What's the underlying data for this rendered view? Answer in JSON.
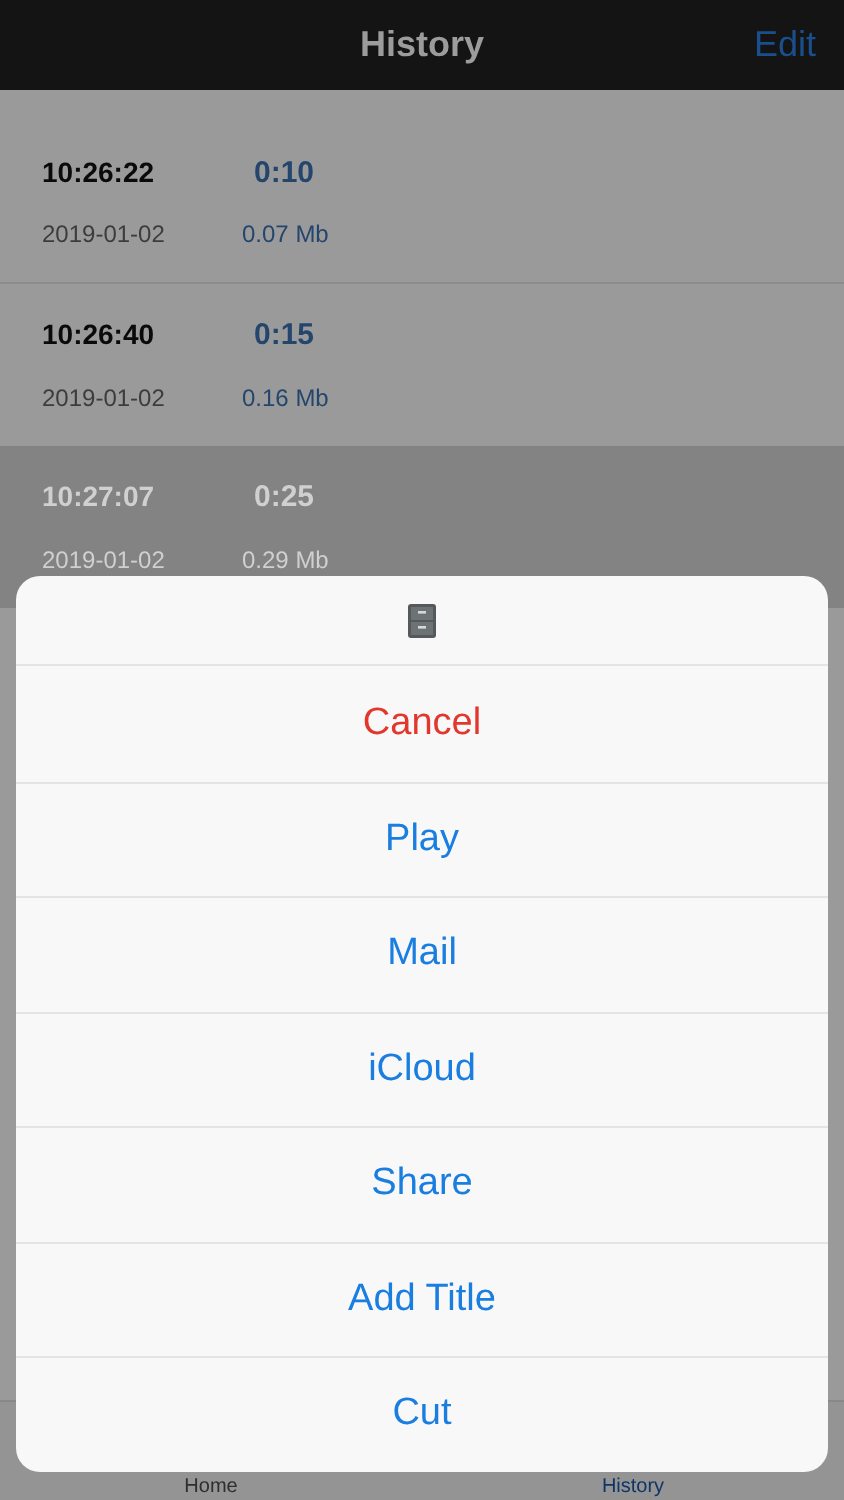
{
  "nav_bar": {
    "title": "History",
    "edit_button": "Edit"
  },
  "recordings": [
    {
      "time": "10:26:22",
      "date": "2019-01-02",
      "duration": "0:10",
      "size": "0.07 Mb",
      "selected": false
    },
    {
      "time": "10:26:40",
      "date": "2019-01-02",
      "duration": "0:15",
      "size": "0.16 Mb",
      "selected": false
    },
    {
      "time": "10:27:07",
      "date": "2019-01-02",
      "duration": "0:25",
      "size": "0.29 Mb",
      "selected": true
    }
  ],
  "action_sheet": {
    "actions": [
      {
        "label": "Cancel",
        "kind": "destructive"
      },
      {
        "label": "Play",
        "kind": "default"
      },
      {
        "label": "Mail",
        "kind": "default"
      },
      {
        "label": "iCloud",
        "kind": "default"
      },
      {
        "label": "Share",
        "kind": "default"
      },
      {
        "label": "Add Title",
        "kind": "default"
      },
      {
        "label": "Cut",
        "kind": "default"
      }
    ]
  },
  "tab_bar": [
    {
      "label": "Home",
      "selected": false
    },
    {
      "label": "History",
      "selected": true
    }
  ]
}
